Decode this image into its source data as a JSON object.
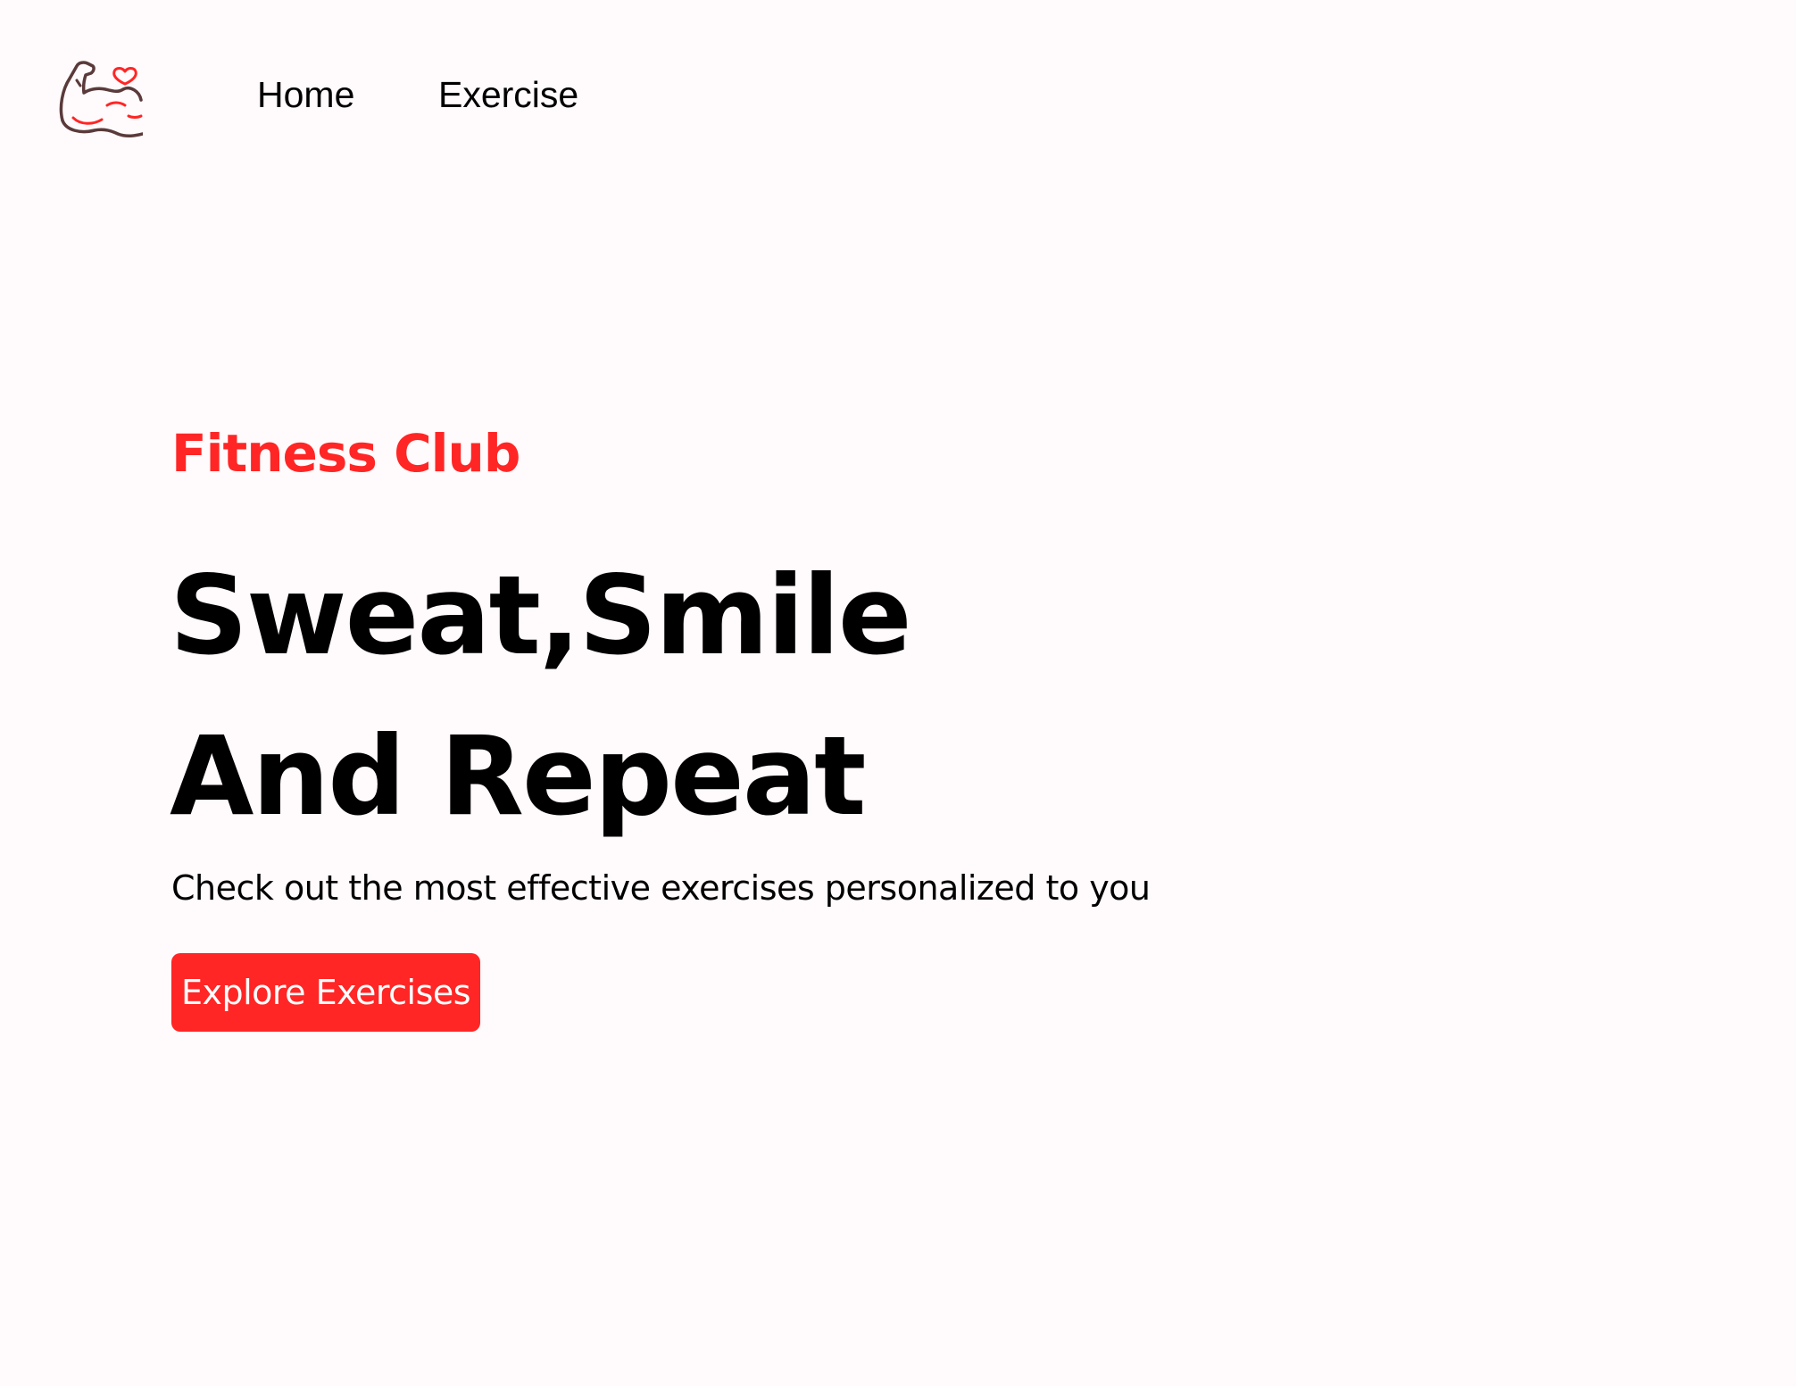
{
  "nav": {
    "logo_icon": "flexed-arm-heart-icon",
    "links": [
      {
        "label": "Home"
      },
      {
        "label": "Exercise"
      }
    ]
  },
  "hero": {
    "eyebrow": "Fitness Club",
    "title_line1": "Sweat,Smile",
    "title_line2": "And Repeat",
    "subtitle": "Check out the most effective exercises personalized to you",
    "cta_label": "Explore Exercises"
  },
  "colors": {
    "accent": "#ff2625",
    "background": "#fffafb",
    "text": "#000000"
  }
}
